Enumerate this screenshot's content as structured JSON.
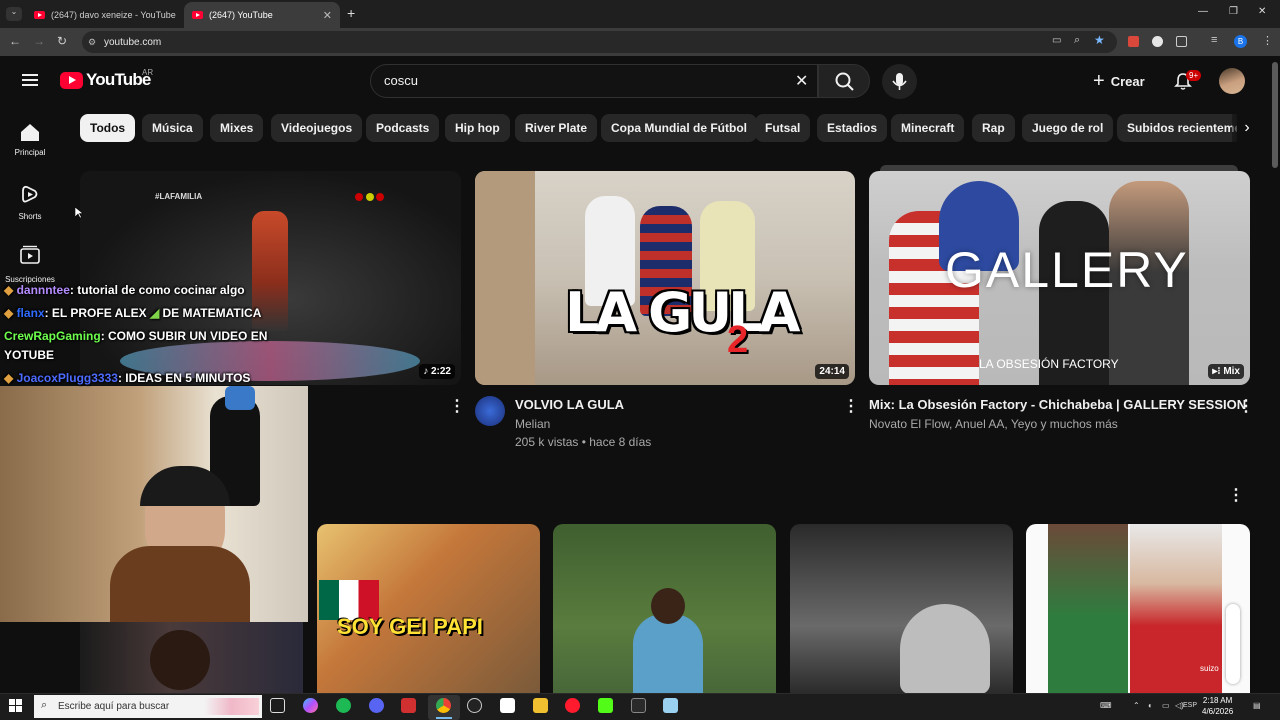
{
  "browser": {
    "tabs": [
      {
        "title": "(2647) davo xeneize - YouTube",
        "close": "✕"
      },
      {
        "title": "(2647) YouTube",
        "close": "✕"
      }
    ],
    "new_tab": "+",
    "url": "youtube.com",
    "window_controls": [
      "—",
      "❐",
      "✕"
    ]
  },
  "masthead": {
    "logo": "YouTube",
    "country": "AR",
    "search_value": "coscu",
    "clear": "✕",
    "create_label": "Crear",
    "notif_badge": "9+"
  },
  "sidebar": [
    {
      "label": "Principal",
      "icon": "home-icon"
    },
    {
      "label": "Shorts",
      "icon": "shorts-icon"
    },
    {
      "label": "Suscripciones",
      "icon": "subscriptions-icon"
    }
  ],
  "chips": [
    "Todos",
    "Música",
    "Mixes",
    "Videojuegos",
    "Podcasts",
    "Hip hop",
    "River Plate",
    "Copa Mundial de Fútbol",
    "Futsal",
    "Estadios",
    "Minecraft",
    "Rap",
    "Juego de rol",
    "Subidos recientemente"
  ],
  "videos": [
    {
      "duration": "♪ 2:22",
      "thumb_text": "#LAFAMILIA"
    },
    {
      "title": "VOLVIO LA GULA",
      "channel": "Melian",
      "meta": "205 k vistas • hace 8 días",
      "duration": "24:14",
      "thumb_text": "LA GULA",
      "thumb_num": "2"
    },
    {
      "title": "Mix: La Obsesión Factory - Chichabeba | GALLERY SESSION",
      "channel": "Novato El Flow, Anuel AA, Yeyo y muchos más",
      "duration": "Mix",
      "thumb_text": "GALLERY",
      "thumb_sub": "LA OBSESIÓN FACTORY"
    }
  ],
  "row2": [
    {
      "thumb_text": "SOY GEI PAPI"
    },
    {
      "thumb_text": ""
    },
    {
      "thumb_text": ""
    },
    {
      "thumb_text": "suizo"
    }
  ],
  "chat": [
    {
      "user": "dannntee",
      "msg": ": tutorial de como cocinar algo",
      "color": "#b48cff"
    },
    {
      "user": "flanx",
      "msg": ": EL PROFE ALEX",
      "msg2": "DE MATEMATICA",
      "color": "#2f6bff"
    },
    {
      "user": "CrewRapGaming",
      "msg": ": COMO SUBIR UN VIDEO EN",
      "msg2": "YOTUBE",
      "color": "#6dff4d"
    },
    {
      "user": "JoacoxPlugg3333",
      "msg": ": IDEAS EN 5 MINUTOS",
      "color": "#4d6bff"
    }
  ],
  "taskbar": {
    "search_placeholder": "Escribe aquí para buscar",
    "lang": "ESP",
    "time": "2:18 AM",
    "date": "4/6/2026"
  },
  "colors": {
    "accent": "#ff0033",
    "bg": "#0f0f0f",
    "chip": "#272727"
  }
}
